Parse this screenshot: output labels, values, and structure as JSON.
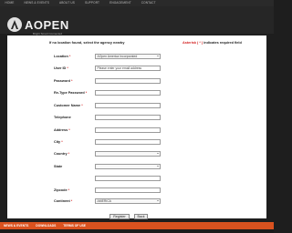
{
  "nav": [
    "HOME",
    "NEWS & EVENTS",
    "ABOUT US",
    "SUPPORT",
    "ENGAGEMENT",
    "CONTACT"
  ],
  "brand": {
    "name": "AOPEN",
    "tagline": "Bright Smart Connected"
  },
  "intro": "If no location found, select the agency nearby",
  "required_note": {
    "star": "Asterisk ( * )",
    "rest": " indicates required field"
  },
  "form": {
    "location": {
      "label": "Location",
      "value": "AOpen America Incorporated"
    },
    "user_id": {
      "label": "User ID",
      "placeholder": "Please enter your email address"
    },
    "password": {
      "label": "Password"
    },
    "retype_password": {
      "label": "Re-Type Password"
    },
    "customer_name": {
      "label": "Customer Name"
    },
    "telephone": {
      "label": "Telephone"
    },
    "address": {
      "label": "Address"
    },
    "city": {
      "label": "City"
    },
    "country": {
      "label": "Country"
    },
    "state": {
      "label": "State"
    },
    "zipcode": {
      "label": "Zipcode"
    },
    "continent": {
      "label": "Continent",
      "value": "AMERICA"
    }
  },
  "buttons": {
    "register": "Register",
    "back": "Back"
  },
  "footer": [
    "NEWS & EVENTS",
    "DOWNLOADS",
    "TERMS OF USE"
  ],
  "colors": {
    "accent": "#d9521f",
    "required": "#d32020",
    "background": "#1e1e1e"
  }
}
